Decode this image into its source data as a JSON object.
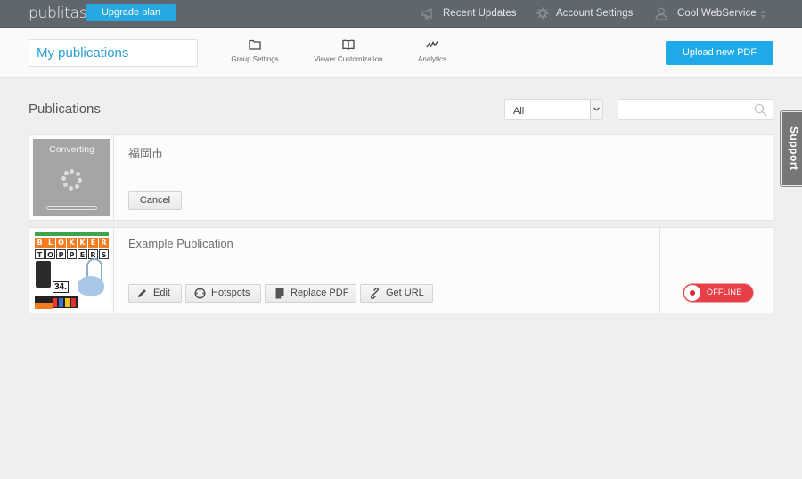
{
  "topbar": {
    "logo": "publitas",
    "upgrade_label": "Upgrade plan",
    "nav": [
      {
        "label": "Recent Updates",
        "icon": "megaphone-icon"
      },
      {
        "label": "Account Settings",
        "icon": "gear-icon"
      },
      {
        "label": "Cool WebService",
        "icon": "user-icon"
      }
    ]
  },
  "subheader": {
    "group_name": "My publications",
    "tools": [
      {
        "label": "Group Settings",
        "icon": "folder-icon"
      },
      {
        "label": "Viewer Customization",
        "icon": "book-icon"
      },
      {
        "label": "Analytics",
        "icon": "analytics-icon"
      }
    ],
    "upload_label": "Upload new PDF"
  },
  "main": {
    "title": "Publications",
    "filter": {
      "selected": "All"
    },
    "search": {
      "value": "",
      "placeholder": ""
    },
    "support_label": "Support"
  },
  "publications": [
    {
      "name": "福岡市",
      "status_text": "Converting",
      "actions": [
        {
          "label": "Cancel"
        }
      ]
    },
    {
      "name": "Example Publication",
      "cover_top": "BLOKKER",
      "cover_bottom": "TOPPERS",
      "cover_price": "34.",
      "actions": [
        {
          "label": "Edit",
          "icon": "pencil-icon"
        },
        {
          "label": "Hotspots",
          "icon": "crosshair-icon"
        },
        {
          "label": "Replace PDF",
          "icon": "document-icon"
        },
        {
          "label": "Get URL",
          "icon": "link-icon"
        }
      ],
      "status": {
        "label": "OFFLINE",
        "color": "#e63f48",
        "online": false
      }
    }
  ],
  "colors": {
    "accent": "#1eaae8",
    "topbar": "#5f666d",
    "offline": "#e63f48"
  }
}
